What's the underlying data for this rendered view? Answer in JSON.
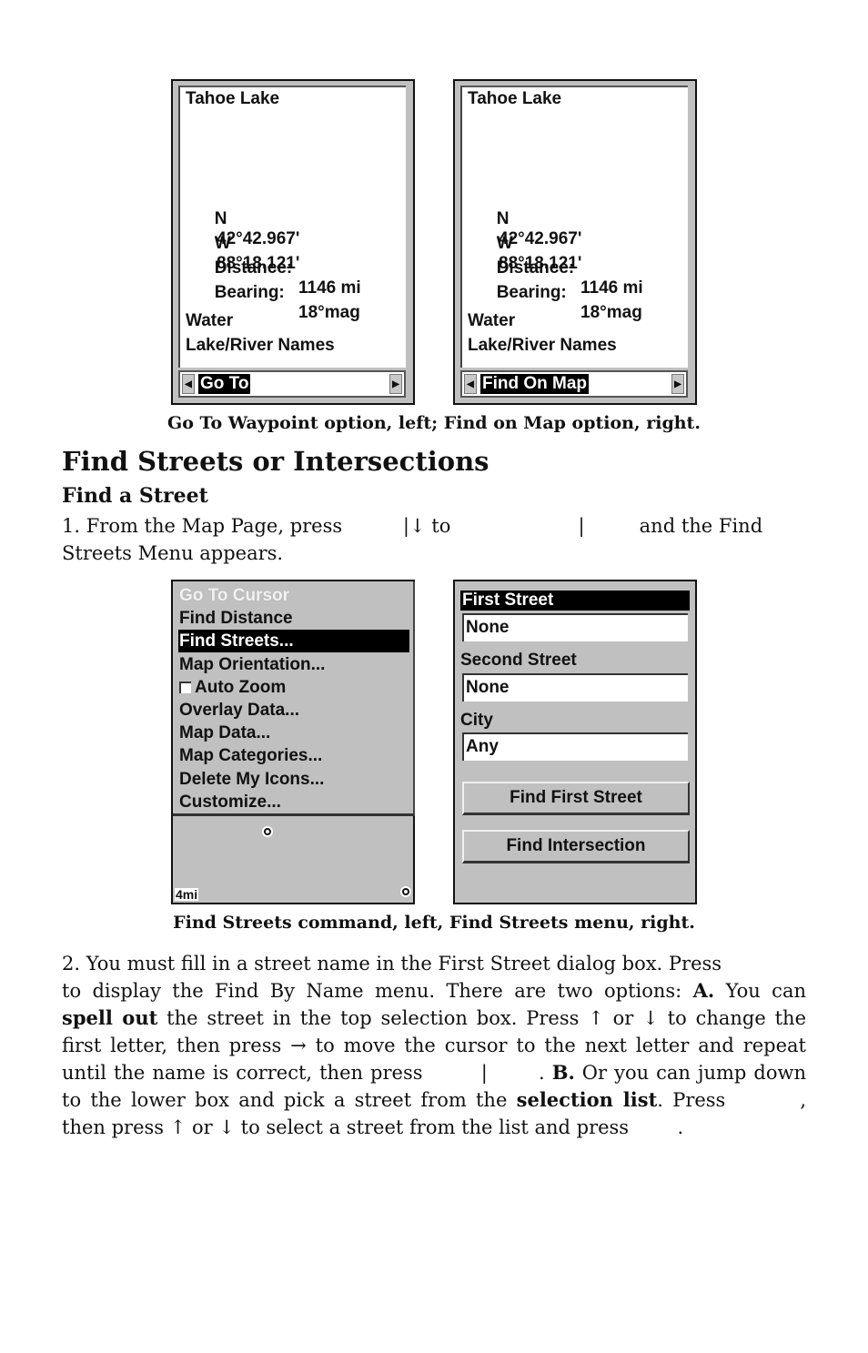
{
  "waypoint_screens": [
    {
      "name": "Tahoe Lake",
      "lat_hemisphere": "N",
      "lat_value": "42°42.967'",
      "lon_hemisphere": "W",
      "lon_value": "88°18.121'",
      "distance_label": "Distance:",
      "distance_value": "1146 mi",
      "bearing_label": "Bearing:",
      "bearing_value": "18°mag",
      "category": "Water",
      "subcategory": "Lake/River Names",
      "selector_value": "Go To",
      "left_arrow": "◀",
      "right_arrow": "▶"
    },
    {
      "name": "Tahoe Lake",
      "lat_hemisphere": "N",
      "lat_value": "42°42.967'",
      "lon_hemisphere": "W",
      "lon_value": "88°18.121'",
      "distance_label": "Distance:",
      "distance_value": "1146 mi",
      "bearing_label": "Bearing:",
      "bearing_value": "18°mag",
      "category": "Water",
      "subcategory": "Lake/River Names",
      "selector_value": "Find On Map",
      "left_arrow": "◀",
      "right_arrow": "▶"
    }
  ],
  "caption1": "Go To Waypoint option, left; Find on Map option, right.",
  "section_title": "Find Streets or Intersections",
  "subsection_title": "Find a Street",
  "step1": {
    "line1": "1. From the Map Page, press          |↓ to                     |         and the Find",
    "line2": "Streets Menu appears."
  },
  "map_menu": {
    "items": [
      {
        "label": "Go To Cursor",
        "state": "disabled"
      },
      {
        "label": "Find Distance",
        "state": "normal"
      },
      {
        "label": "Find Streets...",
        "state": "selected"
      },
      {
        "label": "Map Orientation...",
        "state": "normal"
      },
      {
        "label": "Auto Zoom",
        "state": "checkbox-unchecked"
      },
      {
        "label": "Overlay Data...",
        "state": "normal"
      },
      {
        "label": "Map Data...",
        "state": "normal"
      },
      {
        "label": "Map Categories...",
        "state": "normal"
      },
      {
        "label": "Delete My Icons...",
        "state": "normal"
      },
      {
        "label": "Customize...",
        "state": "normal"
      }
    ],
    "map_scale": "4mi"
  },
  "find_streets_form": {
    "first_street_label": "First Street",
    "first_street_value": "None",
    "second_street_label": "Second Street",
    "second_street_value": "None",
    "city_label": "City",
    "city_value": "Any",
    "find_first_street_button": "Find First Street",
    "find_intersection_button": "Find Intersection"
  },
  "caption2": "Find Streets command, left, Find Streets menu, right.",
  "step2": {
    "l1": "2. You must fill in a street name in the First Street dialog box. Press",
    "l2a": "to display the Find By Name menu. There are two options: ",
    "l2b": "A.",
    "l2c": " You can",
    "l3a": "spell out",
    "l3b": " the street in the top selection box. Press ↑ or ↓ to change the",
    "l4": "first letter, then press → to move the cursor to the next letter and repeat",
    "l5a": "until the name is correct, then press        |       . ",
    "l5b": "B.",
    "l5c": " Or you can jump down",
    "l6a": "to the lower box and pick a street from the ",
    "l6b": "selection list",
    "l6c": ". Press        ,",
    "l7": "then press ↑ or ↓ to select a street from the list and press        ."
  }
}
